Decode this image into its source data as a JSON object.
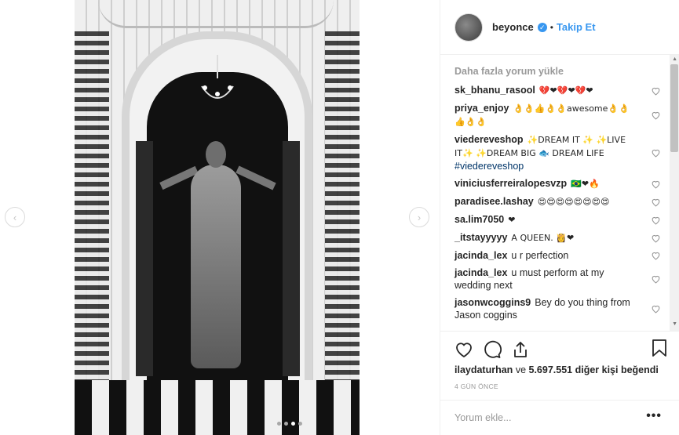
{
  "post": {
    "username": "beyonce",
    "follow_label": "Takip Et",
    "separator": "•",
    "verified_icon": "check-badge-icon"
  },
  "comments": {
    "load_more": "Daha fazla yorum yükle",
    "items": [
      {
        "user": "sk_bhanu_rasool",
        "text": "💔❤💔❤💔❤"
      },
      {
        "user": "priya_enjoy",
        "text": "👌👌👍👌👌awesome👌👌👍👌👌"
      },
      {
        "user": "viedereveshop",
        "text": "✨DREAM IT ✨ ✨LIVE IT✨ ✨DREAM BIG 🐟 DREAM LIFE ",
        "tag": "#viedereveshop"
      },
      {
        "user": "viniciusferreiralopesvzp",
        "text": "🇧🇷❤🔥"
      },
      {
        "user": "paradisee.lashay",
        "text": "😍😍😍😍😍😍😍😍"
      },
      {
        "user": "sa.lim7050",
        "text": "❤"
      },
      {
        "user": "_itstayyyyy",
        "text": "A QUEEN. 👸❤"
      },
      {
        "user": "jacinda_lex",
        "text": "u r perfection"
      },
      {
        "user": "jacinda_lex",
        "text": "u must perform at my wedding next"
      },
      {
        "user": "jasonwcoggins9",
        "text": "Bey do you thing from Jason coggins"
      }
    ]
  },
  "likes": {
    "user": "ilaydaturhan",
    "connector": "ve",
    "count": "5.697.551",
    "suffix": "diğer kişi beğendi"
  },
  "timestamp": "4 GÜN ÖNCE",
  "add_comment": {
    "placeholder": "Yorum ekle...",
    "more_label": "•••"
  },
  "carousel": {
    "left_arrow": "‹",
    "right_arrow": "›"
  },
  "colors": {
    "accent": "#3897f0",
    "text": "#262626",
    "muted": "#999999",
    "border": "#efefef"
  }
}
